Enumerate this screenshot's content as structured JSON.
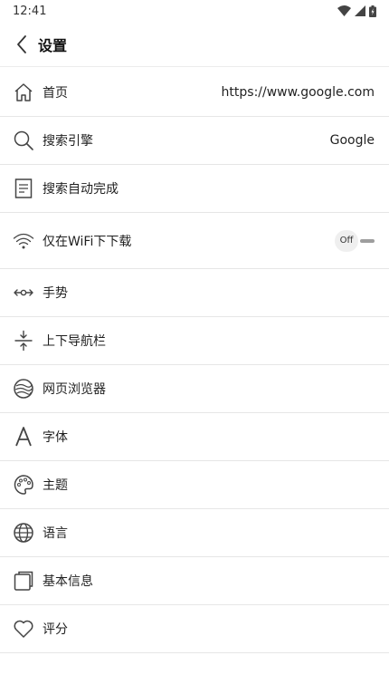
{
  "status_bar": {
    "time": "12:41",
    "icons": [
      "wifi-icon",
      "signal-icon",
      "battery-icon"
    ]
  },
  "app_bar": {
    "back_icon": "chevron-left-icon",
    "title": "设置"
  },
  "settings": [
    {
      "id": "home",
      "icon": "home-icon",
      "label": "首页",
      "value": "https://www.google.com"
    },
    {
      "id": "search-engine",
      "icon": "search-icon",
      "label": "搜索引擎",
      "value": "Google"
    },
    {
      "id": "autocomplete",
      "icon": "document-icon",
      "label": "搜索自动完成",
      "value": ""
    },
    {
      "id": "wifi-download",
      "icon": "wifi-icon",
      "label": "仅在WiFi下下载",
      "toggle": {
        "state": "Off"
      }
    },
    {
      "id": "gestures",
      "icon": "gesture-icon",
      "label": "手势"
    },
    {
      "id": "nav-bar",
      "icon": "collapse-icon",
      "label": "上下导航栏"
    },
    {
      "id": "web-browser",
      "icon": "browser-icon",
      "label": "网页浏览器"
    },
    {
      "id": "font",
      "icon": "font-icon",
      "label": "字体"
    },
    {
      "id": "theme",
      "icon": "palette-icon",
      "label": "主题"
    },
    {
      "id": "language",
      "icon": "globe-icon",
      "label": "语言"
    },
    {
      "id": "about",
      "icon": "info-pages-icon",
      "label": "基本信息"
    },
    {
      "id": "rate",
      "icon": "heart-icon",
      "label": "评分"
    }
  ]
}
